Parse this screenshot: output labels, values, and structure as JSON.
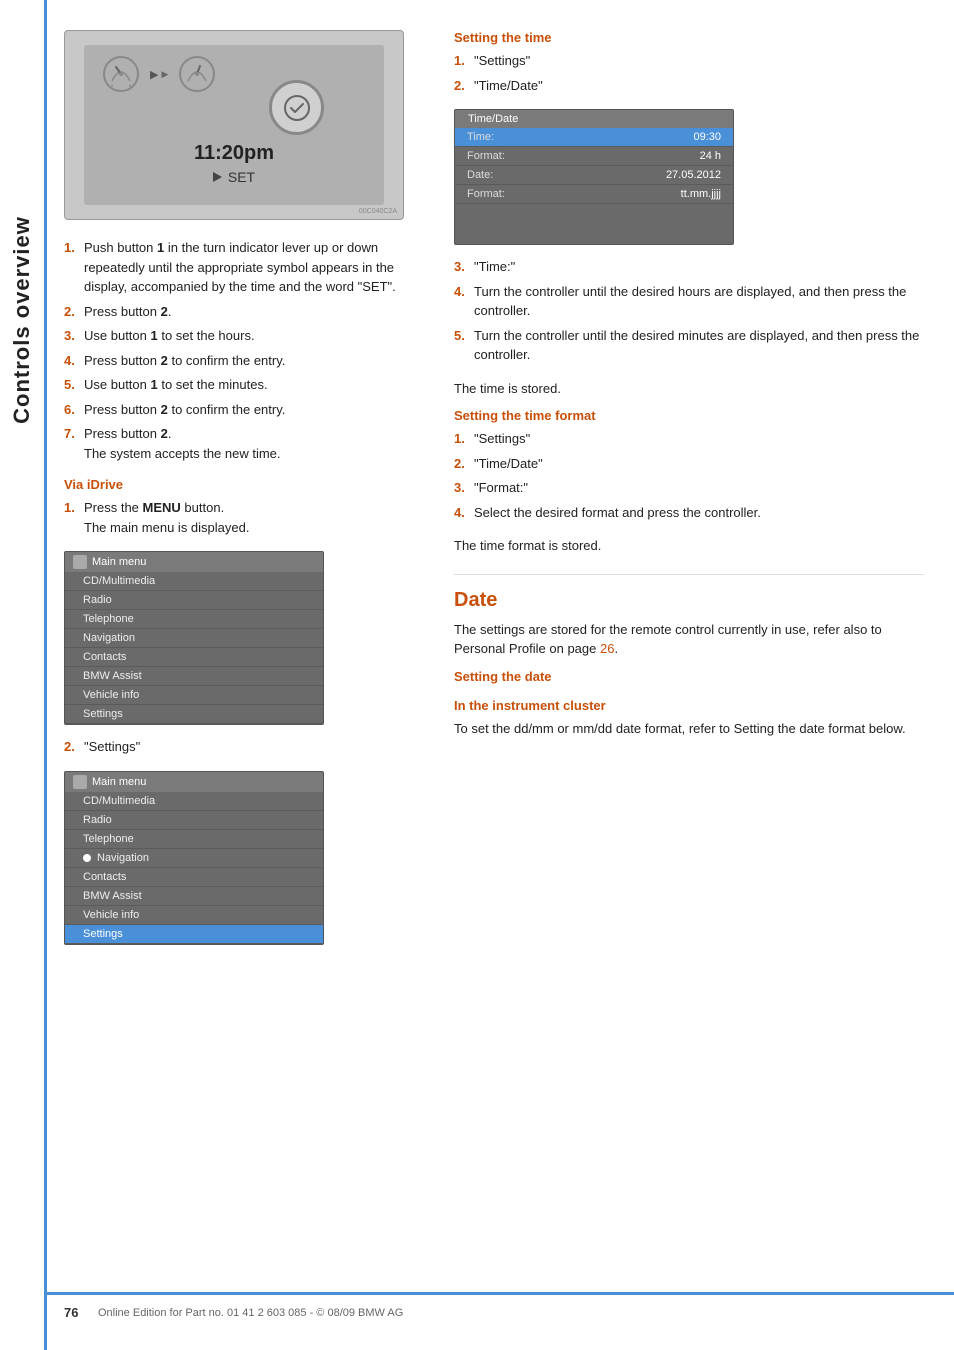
{
  "sidebar": {
    "label": "Controls overview"
  },
  "left_col": {
    "instrument_time": "11:20pm",
    "instrument_set": "SET",
    "steps_intro": [
      {
        "num": "1.",
        "text": "Push button ",
        "bold": "1",
        "rest": " in the turn indicator lever up or down repeatedly until the appropriate symbol appears in the display, accompanied by the time and the word \"SET\"."
      },
      {
        "num": "2.",
        "text": "Press button ",
        "bold": "2",
        "rest": "."
      },
      {
        "num": "3.",
        "text": "Use button ",
        "bold": "1",
        "rest": " to set the hours."
      },
      {
        "num": "4.",
        "text": "Press button ",
        "bold": "2",
        "rest": " to confirm the entry."
      },
      {
        "num": "5.",
        "text": "Use button ",
        "bold": "1",
        "rest": " to set the minutes."
      },
      {
        "num": "6.",
        "text": "Press button ",
        "bold": "2",
        "rest": " to confirm the entry."
      },
      {
        "num": "7.",
        "text": "Press button ",
        "bold": "2",
        "rest": ".\nThe system accepts the new time."
      }
    ],
    "via_idrive_heading": "Via iDrive",
    "via_idrive_steps": [
      {
        "num": "1.",
        "text": "Press the ",
        "bold": "MENU",
        "rest": " button.\nThe main menu is displayed."
      },
      {
        "num": "2.",
        "text": "\"Settings\""
      }
    ],
    "menu1": {
      "title": "Main menu",
      "items": [
        "CD/Multimedia",
        "Radio",
        "Telephone",
        "Navigation",
        "Contacts",
        "BMW Assist",
        "Vehicle info",
        "Settings"
      ]
    },
    "menu2": {
      "title": "Main menu",
      "items": [
        "CD/Multimedia",
        "Radio",
        "Telephone",
        "Navigation",
        "Contacts",
        "BMW Assist",
        "Vehicle info",
        "Settings"
      ],
      "active": "Settings"
    }
  },
  "right_col": {
    "setting_time_heading": "Setting the time",
    "setting_time_steps": [
      {
        "num": "1.",
        "text": "\"Settings\""
      },
      {
        "num": "2.",
        "text": "\"Time/Date\""
      }
    ],
    "timedate_screen": {
      "title": "Time/Date",
      "rows": [
        {
          "label": "Time:",
          "value": "09:30",
          "highlighted": true
        },
        {
          "label": "Format:",
          "value": "24 h"
        },
        {
          "label": "Date:",
          "value": "27.05.2012"
        },
        {
          "label": "Format:",
          "value": "tt.mm.jjjj"
        }
      ]
    },
    "setting_time_steps2": [
      {
        "num": "3.",
        "text": "\"Time:\""
      },
      {
        "num": "4.",
        "text": "Turn the controller until the desired hours are displayed, and then press the controller."
      },
      {
        "num": "5.",
        "text": "Turn the controller until the desired minutes are displayed, and then press the controller."
      }
    ],
    "time_stored": "The time is stored.",
    "setting_time_format_heading": "Setting the time format",
    "setting_time_format_steps": [
      {
        "num": "1.",
        "text": "\"Settings\""
      },
      {
        "num": "2.",
        "text": "\"Time/Date\""
      },
      {
        "num": "3.",
        "text": "\"Format:\""
      },
      {
        "num": "4.",
        "text": "Select the desired format and press the controller."
      }
    ],
    "time_format_stored": "The time format is stored.",
    "date_section_title": "Date",
    "date_body": "The settings are stored for the remote control currently in use, refer also to Personal Profile on page ",
    "date_page_ref": "26",
    "date_body_end": ".",
    "setting_date_heading": "Setting the date",
    "instrument_cluster_heading": "In the instrument cluster",
    "instrument_cluster_body": "To set the dd/mm or mm/dd date format, refer to Setting the date format below."
  },
  "footer": {
    "page_number": "76",
    "text": "Online Edition for Part no. 01 41 2 603 085 - © 08/09 BMW AG"
  }
}
